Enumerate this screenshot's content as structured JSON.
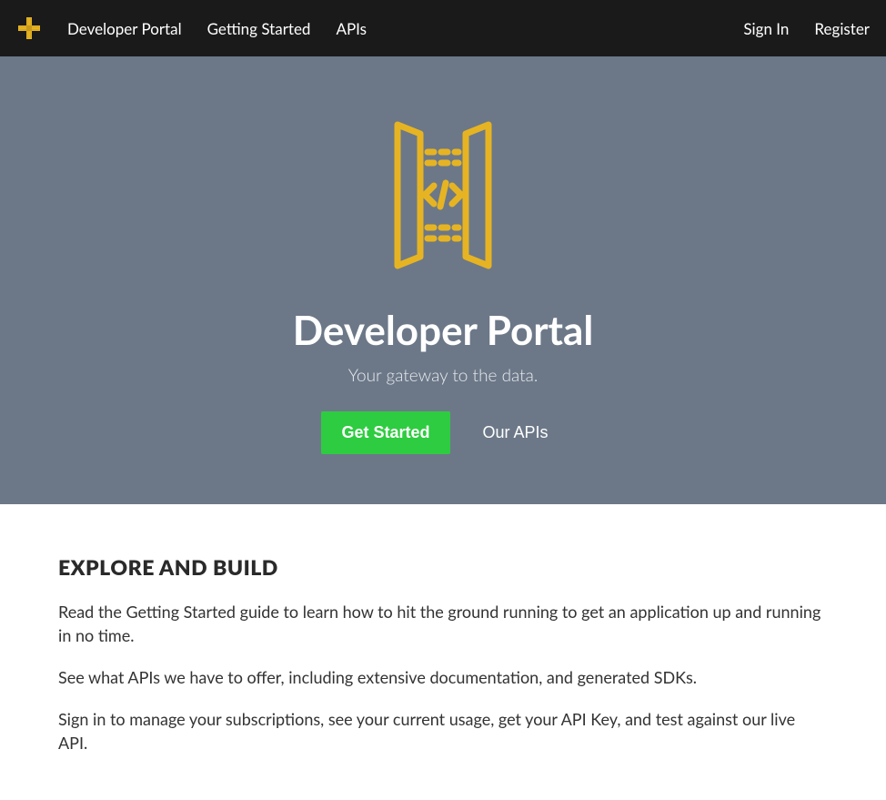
{
  "nav": {
    "brand": "Developer Portal",
    "links": {
      "getting_started": "Getting Started",
      "apis": "APIs"
    },
    "right": {
      "signin": "Sign In",
      "register": "Register"
    }
  },
  "hero": {
    "title": "Developer Portal",
    "subtitle": "Your gateway to the data.",
    "btn_primary": "Get Started",
    "btn_secondary": "Our APIs"
  },
  "content": {
    "heading": "EXPLORE AND BUILD",
    "p1": "Read the Getting Started guide to learn how to hit the ground running to get an application up and running in no time.",
    "p2": "See what APIs we have to offer, including extensive documentation, and generated SDKs.",
    "p3": "Sign in to manage your subscriptions, see your current usage, get your API Key, and test against our live API."
  },
  "colors": {
    "gold": "#e6b422",
    "green": "#2ecc40",
    "hero_bg": "#6c7888",
    "navbar_bg": "#1a1a1a"
  }
}
